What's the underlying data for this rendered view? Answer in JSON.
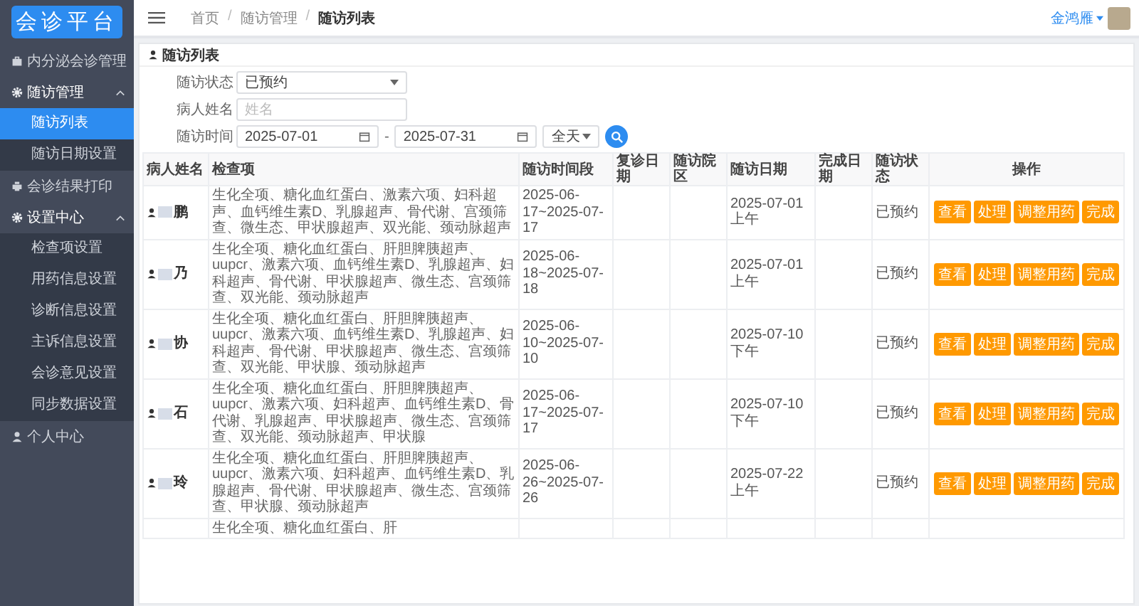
{
  "logo": "会诊平台",
  "sidebar": {
    "items": [
      {
        "label": "内分泌会诊管理",
        "expanded": false
      },
      {
        "label": "随访管理",
        "expanded": true,
        "children": [
          {
            "label": "随访列表",
            "selected": true
          },
          {
            "label": "随访日期设置",
            "selected": false
          }
        ]
      },
      {
        "label": "会诊结果打印",
        "expanded": false
      },
      {
        "label": "设置中心",
        "expanded": true,
        "children": [
          {
            "label": "检查项设置",
            "selected": false
          },
          {
            "label": "用药信息设置",
            "selected": false
          },
          {
            "label": "诊断信息设置",
            "selected": false
          },
          {
            "label": "主诉信息设置",
            "selected": false
          },
          {
            "label": "会诊意见设置",
            "selected": false
          },
          {
            "label": "同步数据设置",
            "selected": false
          }
        ]
      },
      {
        "label": "个人中心",
        "expanded": false
      }
    ]
  },
  "breadcrumbs": {
    "separator": "/",
    "items": [
      "首页",
      "随访管理",
      "随访列表"
    ]
  },
  "user": {
    "name": "金鸿雁"
  },
  "card": {
    "title": "随访列表"
  },
  "filters": {
    "status": {
      "label": "随访状态",
      "value": "已预约"
    },
    "name": {
      "label": "病人姓名",
      "placeholder": "姓名"
    },
    "time": {
      "label": "随访时间",
      "start": "2025-07-01",
      "dash": "-",
      "end": "2025-07-31",
      "range": "全天"
    }
  },
  "table": {
    "columns": [
      "病人姓名",
      "检查项",
      "随访时间段",
      "复诊日期",
      "随访院区",
      "随访日期",
      "完成日期",
      "随访状态",
      "操作"
    ],
    "rows": [
      {
        "name": "鹏",
        "items": "生化全项、糖化血红蛋白、激素六项、妇科超声、血钙维生素D、乳腺超声、骨代谢、宫颈筛查、微生态、甲状腺超声、双光能、颈动脉超声",
        "period": "2025-06-17~2025-07-17",
        "date": "2025-07-01 上午",
        "status": "已预约",
        "actions": [
          "查看",
          "处理",
          "调整用药",
          "完成"
        ]
      },
      {
        "name": "乃",
        "items": "生化全项、糖化血红蛋白、肝胆脾胰超声、uupcr、激素六项、血钙维生素D、乳腺超声、妇科超声、骨代谢、甲状腺超声、微生态、宫颈筛查、双光能、颈动脉超声",
        "period": "2025-06-18~2025-07-18",
        "date": "2025-07-01 上午",
        "status": "已预约",
        "actions": [
          "查看",
          "处理",
          "调整用药",
          "完成"
        ]
      },
      {
        "name": "协",
        "items": "生化全项、糖化血红蛋白、肝胆脾胰超声、uupcr、激素六项、血钙维生素D、乳腺超声、妇科超声、骨代谢、甲状腺超声、微生态、宫颈筛查、双光能、甲状腺、颈动脉超声",
        "period": "2025-06-10~2025-07-10",
        "date": "2025-07-10 下午",
        "status": "已预约",
        "actions": [
          "查看",
          "处理",
          "调整用药",
          "完成"
        ]
      },
      {
        "name": "石",
        "items": "生化全项、糖化血红蛋白、肝胆脾胰超声、uupcr、激素六项、妇科超声、血钙维生素D、骨代谢、乳腺超声、甲状腺超声、微生态、宫颈筛查、双光能、颈动脉超声、甲状腺",
        "period": "2025-06-17~2025-07-17",
        "date": "2025-07-10 下午",
        "status": "已预约",
        "actions": [
          "查看",
          "处理",
          "调整用药",
          "完成"
        ]
      },
      {
        "name": "玲",
        "items": "生化全项、糖化血红蛋白、肝胆脾胰超声、uupcr、激素六项、妇科超声、血钙维生素D、乳腺超声、骨代谢、甲状腺超声、微生态、宫颈筛查、甲状腺、颈动脉超声",
        "period": "2025-06-26~2025-07-26",
        "date": "2025-07-22 上午",
        "status": "已预约",
        "actions": [
          "查看",
          "处理",
          "调整用药",
          "完成"
        ]
      },
      {
        "items": "生化全项、糖化血红蛋白、肝"
      }
    ]
  }
}
